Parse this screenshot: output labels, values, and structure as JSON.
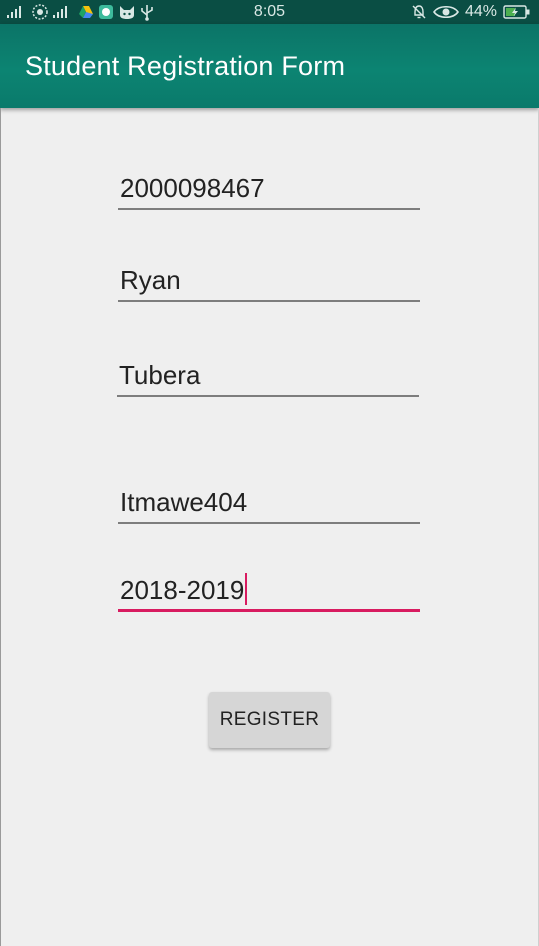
{
  "status_bar": {
    "time": "8:05",
    "battery": "44%",
    "icons_left": [
      "signal-icon",
      "hotspot-icon",
      "signal-icon",
      "drive-icon",
      "messenger-icon",
      "cat-icon",
      "usb-icon"
    ],
    "icons_right": [
      "mute-icon",
      "eye-icon",
      "battery-charging-icon"
    ]
  },
  "app_bar": {
    "title": "Student Registration Form",
    "color": "#0b7b6c"
  },
  "form": {
    "fields": [
      {
        "value": "2000098467"
      },
      {
        "value": "Ryan"
      },
      {
        "value": "Tubera"
      },
      {
        "value": "Itmawe404"
      },
      {
        "value": "2018-2019"
      }
    ],
    "register_label": "REGISTER",
    "accent": "#d81b60"
  }
}
